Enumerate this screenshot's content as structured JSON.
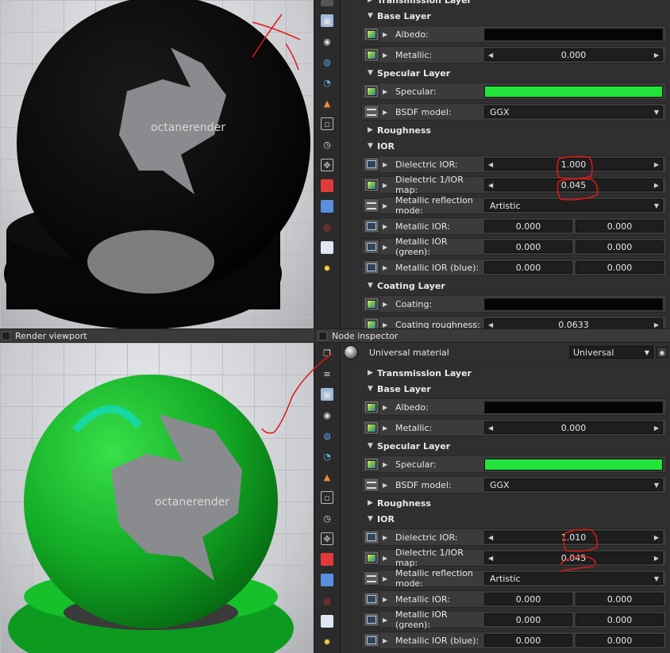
{
  "panes": {
    "render_viewport_title": "Render viewport",
    "node_inspector_title": "Node inspector"
  },
  "material": {
    "name": "Universal material",
    "type": "Universal"
  },
  "logo_text": "octanerender",
  "sections": {
    "transmission": "Transmission Layer",
    "base": "Base Layer",
    "specular": "Specular Layer",
    "roughness": "Roughness",
    "ior": "IOR",
    "coating": "Coating Layer"
  },
  "labels": {
    "albedo": "Albedo:",
    "metallic": "Metallic:",
    "specular": "Specular:",
    "bsdf": "BSDF model:",
    "dielectric_ior": "Dielectric IOR:",
    "dielectric_map": "Dielectric 1/IOR map:",
    "metallic_mode": "Metallic reflection mode:",
    "metallic_ior": "Metallic IOR:",
    "metallic_ior_green": "Metallic IOR (green):",
    "metallic_ior_blue": "Metallic IOR (blue):",
    "coating": "Coating:",
    "coating_partial": "Coating roughness:"
  },
  "top_inspector": {
    "metallic": "0.000",
    "bsdf": "GGX",
    "dielectric_ior": "1.000",
    "dielectric_map": "0.045",
    "metallic_mode": "Artistic",
    "metallic_ior": [
      "0.000",
      "0.000"
    ],
    "metallic_ior_green": [
      "0.000",
      "0.000"
    ],
    "metallic_ior_blue": [
      "0.000",
      "0.000"
    ],
    "coating_partial_value": "0.0633"
  },
  "bottom_inspector": {
    "metallic": "0.000",
    "bsdf": "GGX",
    "dielectric_ior": "1.010",
    "dielectric_map": "0.045",
    "metallic_mode": "Artistic",
    "metallic_ior": [
      "0.000",
      "0.000"
    ],
    "metallic_ior_green": [
      "0.000",
      "0.000"
    ],
    "metallic_ior_blue": [
      "0.000",
      "0.000"
    ]
  },
  "colors": {
    "albedo": "#050505",
    "specular": "#22e33a",
    "coating": "#050505",
    "annotation": "#e01818",
    "black_material": "#0a0a0a",
    "green_material": "#17b72a"
  },
  "toolstrip_icons": [
    "image-icon",
    "camera-icon",
    "database-icon",
    "environment-icon",
    "material-icon",
    "frame-icon",
    "clock-icon",
    "transform-icon",
    "geometry-cube-icon",
    "layers-icon",
    "sphere-icon",
    "picture-icon",
    "light-icon"
  ]
}
